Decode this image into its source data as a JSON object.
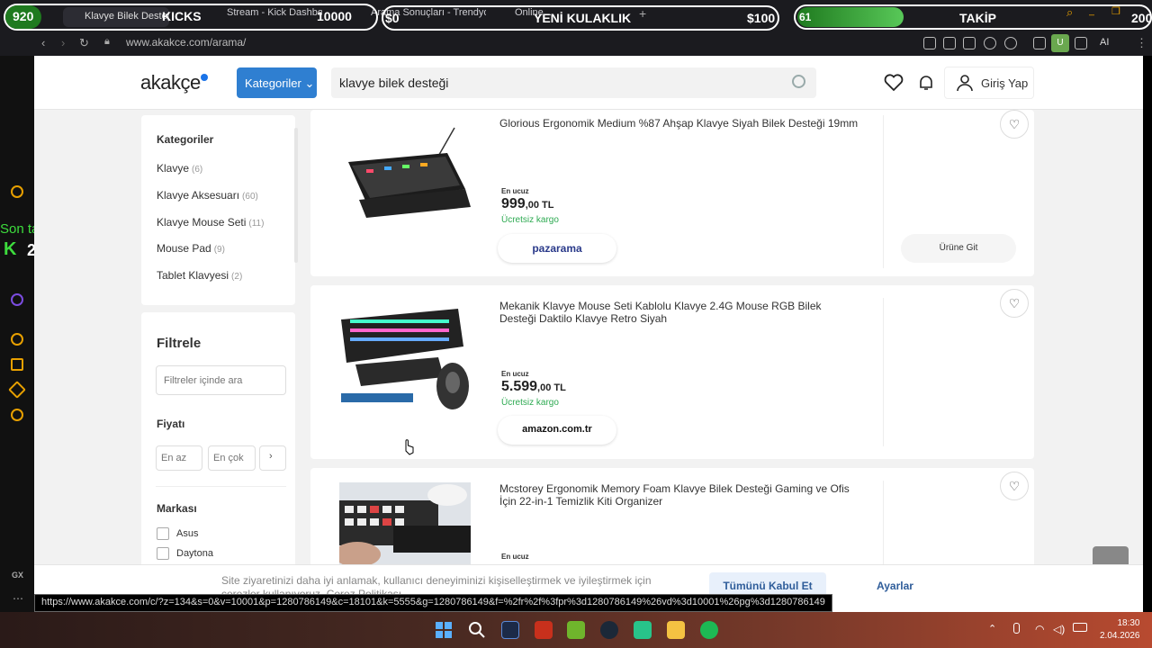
{
  "browser": {
    "tabs": [
      {
        "label": "Klavye Bilek Desteği"
      },
      {
        "label": "Stream - Kick Dashboard"
      },
      {
        "label": "Arama Sonuçları - Trendyol"
      },
      {
        "label": "Online..."
      }
    ],
    "url": "www.akakce.com/arama/",
    "status_url": "https://www.akakce.com/c/?z=134&s=0&v=10001&p=1280786149&c=18101&k=5555&g=1280786149&f=%2fr%2f%3fpr%3d1280786149%26vd%3d10001%26pg%3d1280786149",
    "ext_badge": "U",
    "ai_label": "AI"
  },
  "overlay": {
    "viewers": "920",
    "kicks_label": "KICKS",
    "kicks_value": "10000",
    "money_left": "$0",
    "headline": "YENİ KULAKLIK",
    "money_right": "$100",
    "follow_progress": "61",
    "follow_label": "TAKİP",
    "follow_goal": "200",
    "last_follower": "Son takipçi: helenhera",
    "k_count": "2",
    "gx_label": "GX"
  },
  "header": {
    "logo": "akakçe",
    "categories_button": "Kategoriler",
    "search_value": "klavye bilek desteği",
    "login_label": "Giriş Yap"
  },
  "sidebar": {
    "categories_title": "Kategoriler",
    "categories": [
      {
        "name": "Klavye",
        "count": "(6)"
      },
      {
        "name": "Klavye Aksesuarı",
        "count": "(60)"
      },
      {
        "name": "Klavye Mouse Seti",
        "count": "(11)"
      },
      {
        "name": "Mouse Pad",
        "count": "(9)"
      },
      {
        "name": "Tablet Klavyesi",
        "count": "(2)"
      }
    ],
    "filter_title": "Filtrele",
    "filter_search_placeholder": "Filtreler içinde ara",
    "price_title": "Fiyatı",
    "price_min_placeholder": "En az",
    "price_max_placeholder": "En çok",
    "brand_title": "Markası",
    "brands": [
      "Asus",
      "Daytona"
    ]
  },
  "products": [
    {
      "title": "Glorious Ergonomik Medium %87 Ahşap Klavye Siyah Bilek Desteği 19mm",
      "cheapest_label": "En ucuz",
      "price_main": "999",
      "price_rest": ",00 TL",
      "shipping": "Ücretsiz kargo",
      "store": "pazarama",
      "go_button": "Ürüne Git"
    },
    {
      "title": "Mekanik Klavye Mouse Seti Kablolu Klavye 2.4G Mouse RGB Bilek Desteği Daktilo Klavye Retro Siyah",
      "cheapest_label": "En ucuz",
      "price_main": "5.599",
      "price_rest": ",00 TL",
      "shipping": "Ücretsiz kargo",
      "store": "amazon.com.tr"
    },
    {
      "title": "Mcstorey Ergonomik Memory Foam Klavye Bilek Desteği Gaming ve Ofis İçin 22-in-1 Temizlik Kiti Organizer",
      "cheapest_label": "En ucuz"
    }
  ],
  "cookie": {
    "text": "Site ziyaretinizi daha iyi anlamak, kullanıcı deneyiminizi kişiselleştirmek ve iyileştirmek için çerezler kullanıyoruz. Çerez Politikası",
    "accept_label": "Tümünü Kabul Et",
    "settings_label": "Ayarlar"
  },
  "taskbar": {
    "time": "18:30",
    "date": "2.04.2026"
  },
  "colors": {
    "accent": "#2f7fd1",
    "shipping_green": "#2eaa52"
  }
}
